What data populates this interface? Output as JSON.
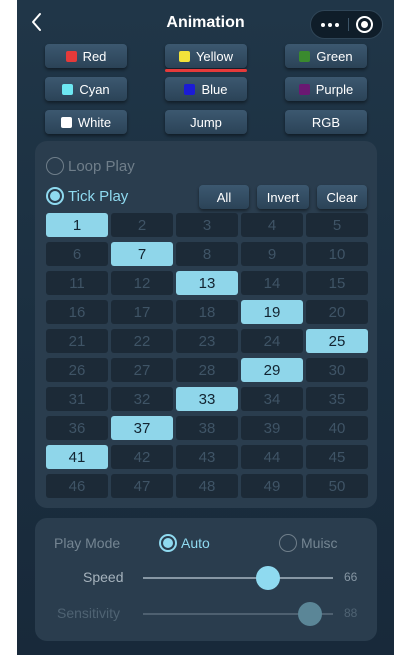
{
  "header": {
    "title": "Animation"
  },
  "colors": {
    "row1": [
      {
        "label": "Red",
        "swatch": "#e53a3a"
      },
      {
        "label": "Yellow",
        "swatch": "#f2e33a"
      },
      {
        "label": "Green",
        "swatch": "#3a8a2e"
      }
    ],
    "row2": [
      {
        "label": "Cyan",
        "swatch": "#6de7f2"
      },
      {
        "label": "Blue",
        "swatch": "#1b1bd6"
      },
      {
        "label": "Purple",
        "swatch": "#6b1872"
      }
    ],
    "row3": [
      {
        "label": "White",
        "swatch": "#ffffff"
      },
      {
        "label": "Jump"
      },
      {
        "label": "RGB"
      }
    ],
    "selected": "Yellow"
  },
  "modes": {
    "loop_play": "Loop Play",
    "tick_play": "Tick Play",
    "selected": "Tick Play"
  },
  "actions": {
    "all": "All",
    "invert": "Invert",
    "clear": "Clear"
  },
  "grid": {
    "numbers": [
      1,
      2,
      3,
      4,
      5,
      6,
      7,
      8,
      9,
      10,
      11,
      12,
      13,
      14,
      15,
      16,
      17,
      18,
      19,
      20,
      21,
      22,
      23,
      24,
      25,
      26,
      27,
      28,
      29,
      30,
      31,
      32,
      33,
      34,
      35,
      36,
      37,
      38,
      39,
      40,
      41,
      42,
      43,
      44,
      45,
      46,
      47,
      48,
      49,
      50
    ],
    "selected": [
      1,
      7,
      13,
      19,
      25,
      29,
      33,
      37,
      41
    ]
  },
  "settings": {
    "play_mode_label": "Play Mode",
    "auto": "Auto",
    "music": "Muisc",
    "play_mode_selected": "Auto",
    "speed_label": "Speed",
    "speed_value": "66",
    "speed_max": 100,
    "sensitivity_label": "Sensitivity",
    "sensitivity_value": "88",
    "sensitivity_max": 100,
    "accent": "#8fdaf0",
    "disabled_accent": "#5b8697"
  }
}
